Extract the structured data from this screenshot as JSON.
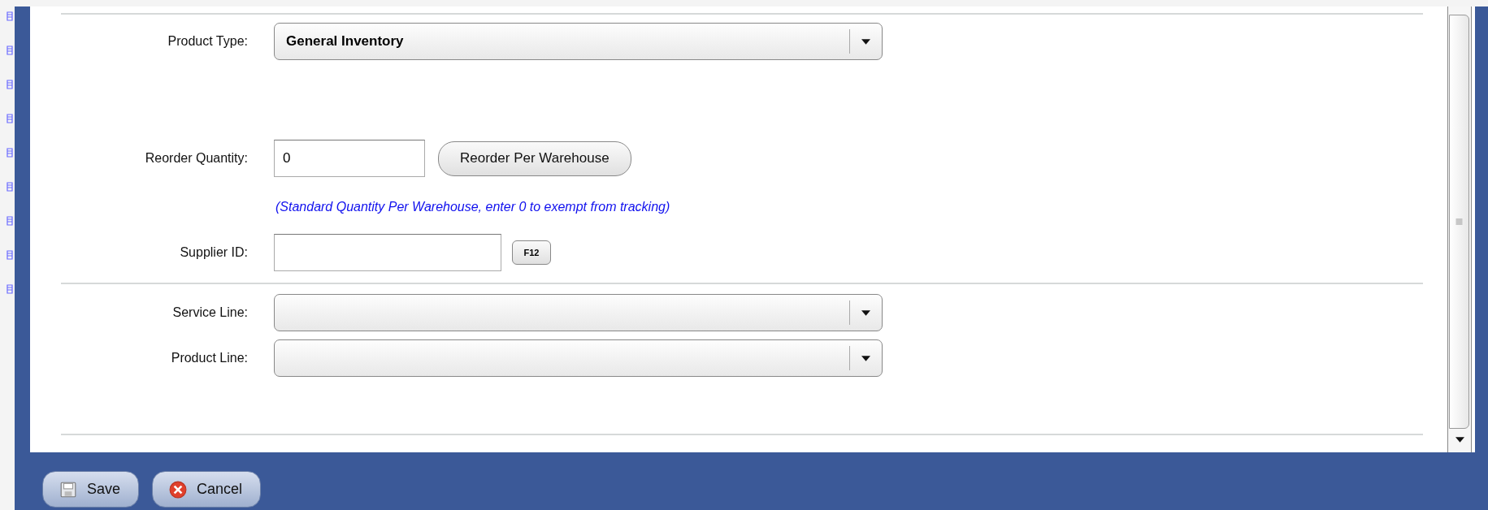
{
  "form": {
    "fields": [
      {
        "kind": "select",
        "label": "Product Type:",
        "value": "General Inventory"
      },
      {
        "kind": "spacer"
      },
      {
        "kind": "quantity",
        "label": "Reorder Quantity:",
        "value": "0",
        "button": "Reorder Per Warehouse",
        "hint": "(Standard Quantity Per Warehouse, enter 0 to exempt from tracking)"
      },
      {
        "kind": "lookup",
        "label": "Supplier ID:",
        "button": "F12"
      },
      {
        "kind": "divider"
      },
      {
        "kind": "select",
        "label": "Service Line:"
      },
      {
        "kind": "select",
        "label": "Product Line:"
      }
    ]
  },
  "buttons": [
    {
      "kind": "save",
      "label": "Save"
    },
    {
      "kind": "cancel",
      "label": "Cancel"
    }
  ]
}
